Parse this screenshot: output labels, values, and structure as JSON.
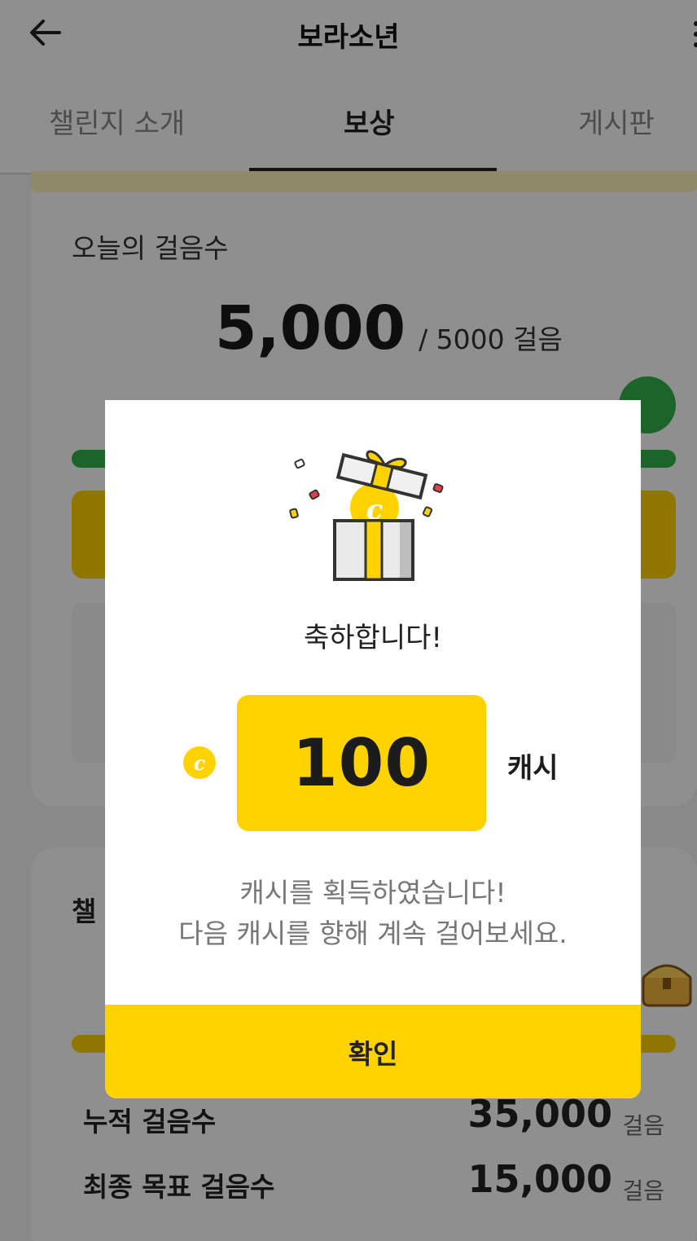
{
  "header": {
    "title": "보라소년"
  },
  "tabs": [
    {
      "label": "챌린지 소개"
    },
    {
      "label": "보상"
    },
    {
      "label": "게시판"
    }
  ],
  "today_card": {
    "label": "오늘의 걸음수",
    "steps": "5,000",
    "goal_text": "/ 5000 걸음",
    "progress": 1.0
  },
  "challenge_card": {
    "label_partial": "챌",
    "stats": [
      {
        "label": "누적 걸음수",
        "value": "35,000",
        "unit": "걸음"
      },
      {
        "label": "최종 목표 걸음수",
        "value": "15,000",
        "unit": "걸음"
      }
    ]
  },
  "modal": {
    "title": "축하합니다!",
    "amount": "100",
    "unit": "캐시",
    "message_line1": "캐시를 획득하였습니다!",
    "message_line2": "다음 캐시를 향해 계속 걸어보세요.",
    "confirm_label": "확인",
    "coin_letter": "c"
  },
  "colors": {
    "accent": "#ffd200",
    "progress_green": "#33b24a",
    "overlay": "rgba(0,0,0,0.44)"
  },
  "icons": [
    "back-arrow-icon",
    "more-icon",
    "gift-box-icon",
    "coin-icon",
    "treasure-chest-icon",
    "walker-icon"
  ]
}
